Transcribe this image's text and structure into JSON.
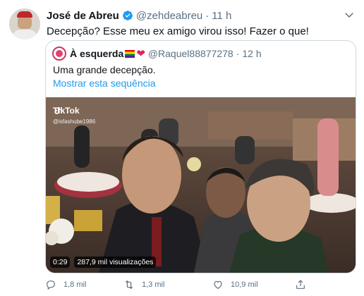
{
  "tweet": {
    "author_name": "José de Abreu",
    "author_handle": "@zehdeabreu",
    "separator": "·",
    "time": "11 h",
    "text": "Decepção? Esse meu ex amigo virou isso! Fazer o que!"
  },
  "quote": {
    "author_name": "À esquerda",
    "author_handle": "@Raquel88877278",
    "separator": "·",
    "time": "12 h",
    "text": "Uma grande decepção.",
    "show_thread_link": "Mostrar esta sequência"
  },
  "video": {
    "watermark": "TikTok",
    "watermark_handle": "@isfashube1986",
    "duration": "0:29",
    "views": "287,9 mil visualizações"
  },
  "actions": {
    "replies": "1,8 mil",
    "retweets": "1,3 mil",
    "likes": "10,9 mil"
  },
  "colors": {
    "accent": "#1d9bf0",
    "muted": "#5b7083",
    "border": "#cfd9de"
  },
  "icons": [
    "verified-badge-icon",
    "chevron-down-icon",
    "tiktok-logo-icon",
    "reply-icon",
    "retweet-icon",
    "like-icon",
    "share-icon"
  ]
}
